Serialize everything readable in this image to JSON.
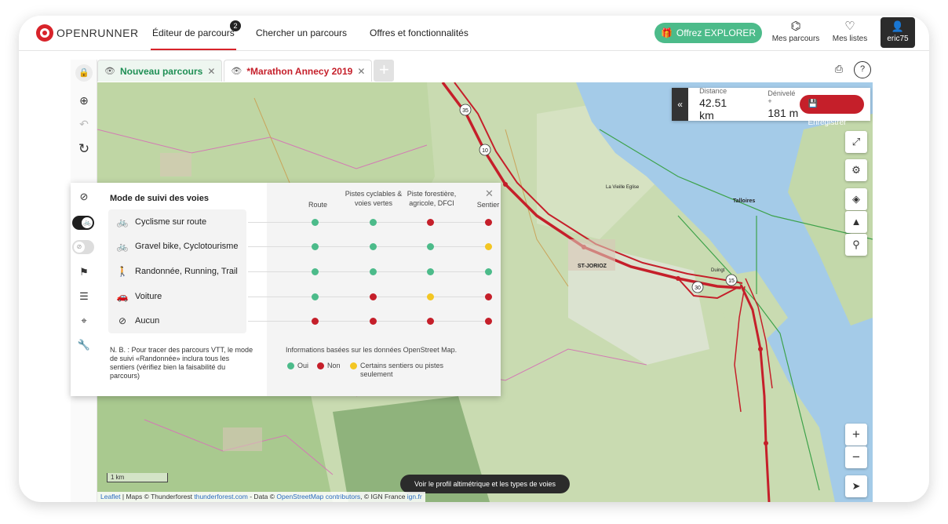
{
  "brand": "OPENRUNNER",
  "nav": {
    "links": [
      "Éditeur de parcours",
      "Chercher un parcours",
      "Offres et fonctionnalités"
    ],
    "editor_badge": "2",
    "explorer_button": "Offrez EXPLORER",
    "my_routes": "Mes parcours",
    "my_lists": "Mes listes",
    "username": "eric75"
  },
  "tabs": [
    {
      "label": "Nouveau parcours",
      "color": "#1f8f55"
    },
    {
      "label": "*Marathon Annecy 2019",
      "color": "#c51f2a"
    }
  ],
  "stats": {
    "distance_label": "Distance",
    "distance_value": "42.51 km",
    "elevation_label": "Dénivelé +",
    "elevation_value": "181 m",
    "save_button": "Enregistrer"
  },
  "mode_panel": {
    "title": "Mode de suivi des voies",
    "columns": [
      {
        "label": "Route"
      },
      {
        "label": "Pistes cyclables & voies vertes"
      },
      {
        "label": "Piste forestière, agricole, DFCI"
      },
      {
        "label": "Sentier"
      }
    ],
    "rows": [
      {
        "label": "Cyclisme sur route",
        "icon": "bike-icon",
        "values": [
          "oui",
          "oui",
          "non",
          "non"
        ]
      },
      {
        "label": "Gravel bike, Cyclotourisme",
        "icon": "bike-icon",
        "values": [
          "oui",
          "oui",
          "oui",
          "partiel"
        ]
      },
      {
        "label": "Randonnée, Running, Trail",
        "icon": "walker-icon",
        "values": [
          "oui",
          "oui",
          "oui",
          "oui"
        ]
      },
      {
        "label": "Voiture",
        "icon": "car-icon",
        "values": [
          "oui",
          "non",
          "partiel",
          "non"
        ]
      },
      {
        "label": "Aucun",
        "icon": "none-icon",
        "values": [
          "non",
          "non",
          "non",
          "non"
        ]
      }
    ],
    "note": "N. B. : Pour tracer des parcours VTT, le mode de suivi «Randonnée» inclura tous les sentiers (vérifiez bien la faisabilité du parcours)",
    "info": "Informations basées sur les données OpenStreet Map.",
    "legend": {
      "yes": "Oui",
      "no": "Non",
      "partial": "Certains sentiers ou pistes seulement"
    },
    "colors": {
      "oui": "#4cbb8a",
      "non": "#c51f2a",
      "partiel": "#f3c623"
    }
  },
  "map": {
    "scale": "1 km",
    "profile_button": "Voir le profil altimétrique et les types de voies",
    "attribution": {
      "leaflet": "Leaflet",
      "maps": " | Maps © Thunderforest ",
      "thunderforest": "thunderforest.com",
      "data": " - Data © ",
      "osm": "OpenStreetMap contributors",
      "ign": ", © IGN France ",
      "ign_link": "ign.fr"
    },
    "road_numbers": [
      "35",
      "10",
      "15",
      "30"
    ],
    "place_labels": [
      "ST-JORIOZ",
      "Talloires",
      "La Vieille Eglise",
      "Duingt"
    ]
  }
}
